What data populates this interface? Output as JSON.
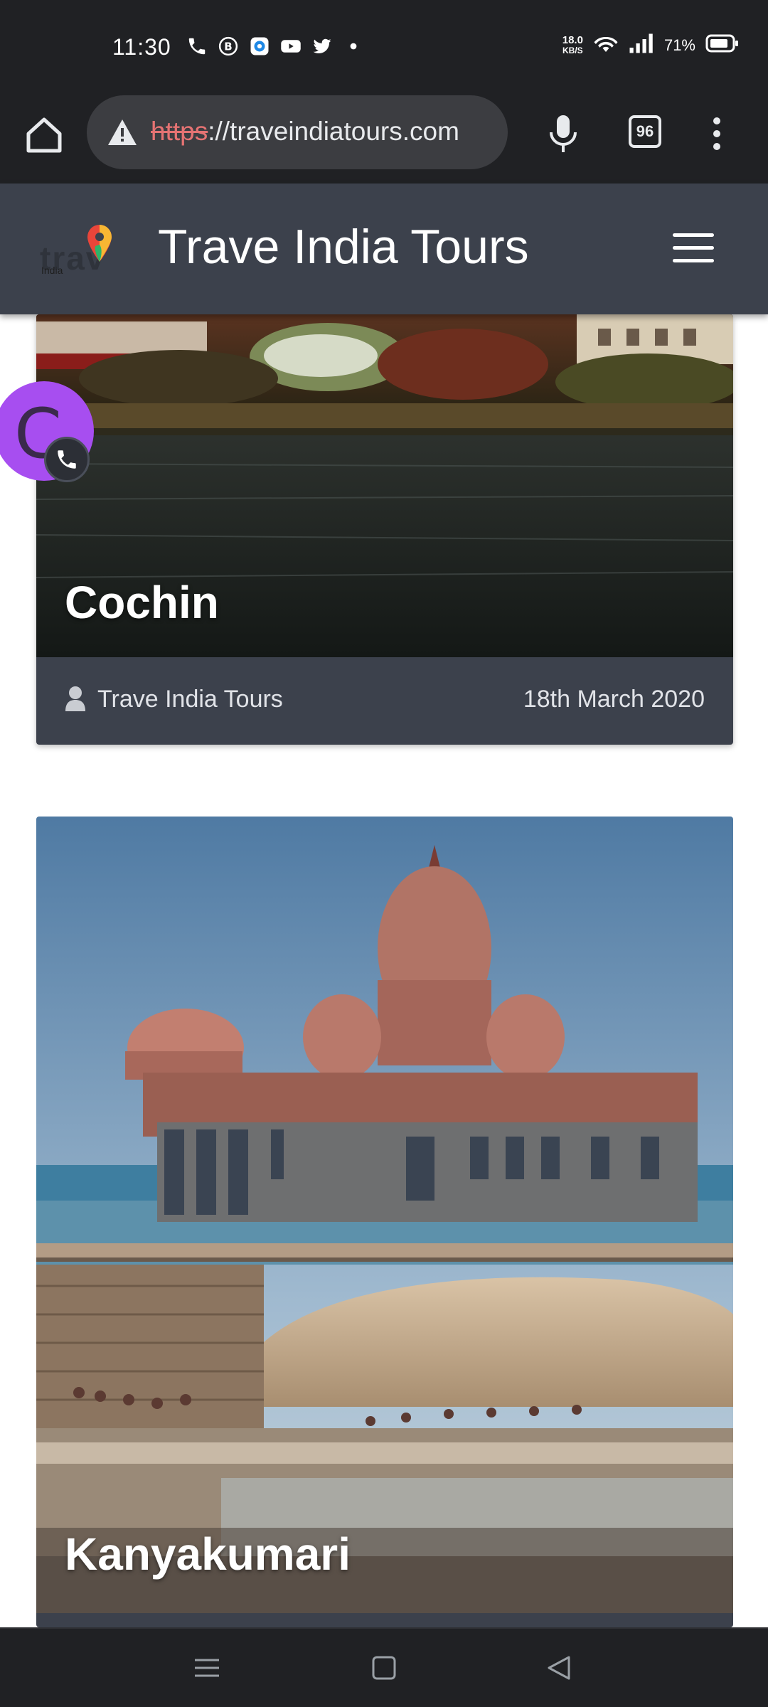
{
  "status_bar": {
    "time": "11:30",
    "net_speed_value": "18.0",
    "net_speed_unit": "KB/S",
    "battery": "71%"
  },
  "browser": {
    "url_scheme": "https",
    "url_rest": "://traveindiatours.com",
    "tab_count": "96"
  },
  "site": {
    "title": "Trave India Tours",
    "logo_small": "India"
  },
  "cards": [
    {
      "title": "Cochin",
      "author": "Trave India Tours",
      "date": "18th March 2020"
    },
    {
      "title": "Kanyakumari"
    }
  ],
  "chat_bubble": {
    "letter": "C"
  },
  "colors": {
    "header_bg": "#3c414c",
    "system_bar": "#202124",
    "bubble": "#a74ef0"
  }
}
